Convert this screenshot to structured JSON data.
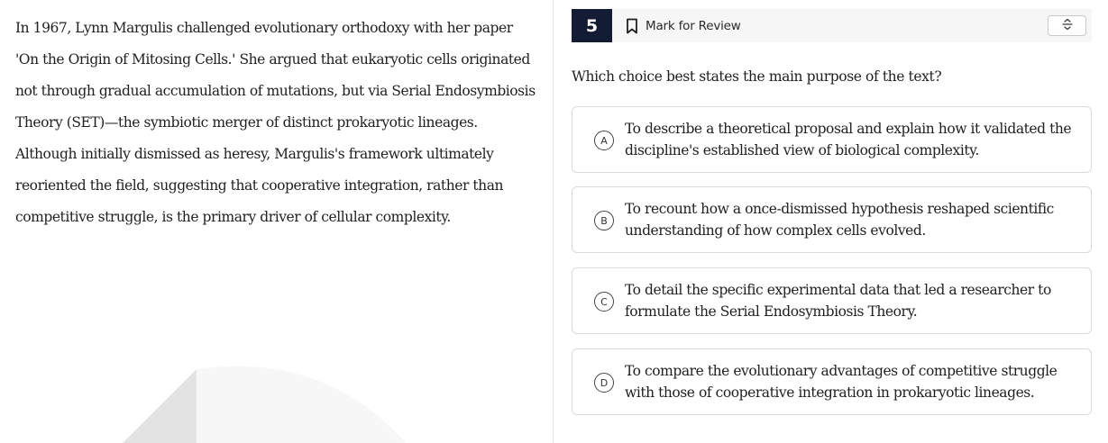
{
  "passage": {
    "text": "In 1967, Lynn Margulis challenged evolutionary orthodoxy with her paper 'On the Origin of Mitosing Cells.' She argued that eukaryotic cells originated not through gradual accumulation of mutations, but via Serial Endosymbiosis Theory (SET)—the symbiotic merger of distinct prokaryotic lineages. Although initially dismissed as heresy, Margulis's framework ultimately reoriented the field, suggesting that cooperative integration, rather than competitive struggle, is the primary driver of cellular complexity."
  },
  "header": {
    "question_number": "5",
    "mark_for_review_label": "Mark for Review",
    "strikethrough_icon": "strikethrough-icon",
    "bookmark_icon": "bookmark-icon"
  },
  "question": {
    "prompt": "Which choice best states the main purpose of the text?"
  },
  "choices": [
    {
      "letter": "A",
      "text": "To describe a theoretical proposal and explain how it validated the discipline's established view of biological complexity."
    },
    {
      "letter": "B",
      "text": "To recount how a once-dismissed hypothesis reshaped scientific understanding of how complex cells evolved."
    },
    {
      "letter": "C",
      "text": "To detail the specific experimental data that led a researcher to formulate the Serial Endosymbiosis Theory."
    },
    {
      "letter": "D",
      "text": "To compare the evolutionary advantages of competitive struggle with those of cooperative integration in prokaryotic lineages."
    }
  ],
  "colors": {
    "number_badge_bg": "#141c33",
    "header_bg": "#f6f6f7",
    "choice_border": "#dadada"
  }
}
